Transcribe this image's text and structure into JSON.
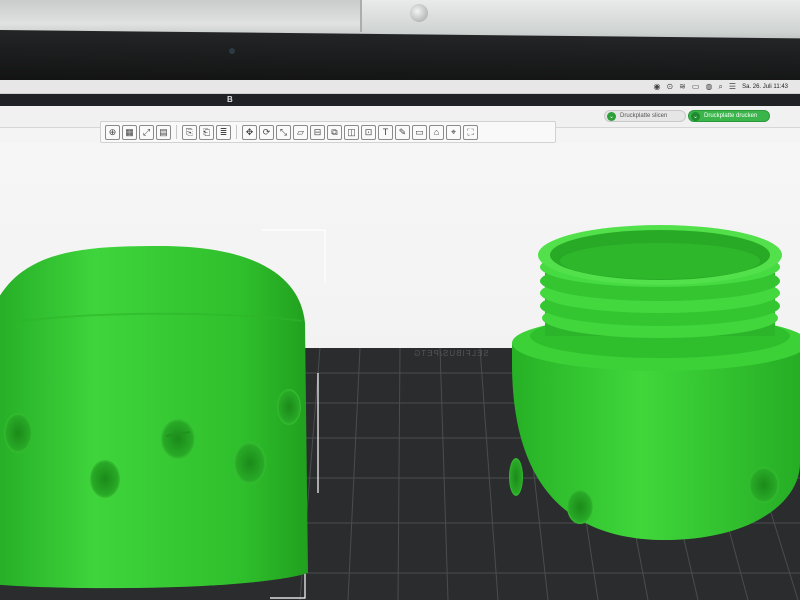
{
  "menubar": {
    "clock": "Sa. 26. Juli  11:43",
    "icons": [
      "record-icon",
      "control-icon",
      "wifi-icon",
      "cast-icon",
      "user-icon",
      "search-icon",
      "control-center-icon"
    ]
  },
  "app": {
    "title_glyph": "B"
  },
  "slicebar": {
    "slice_label": "Druckplatte slicen",
    "print_label": "Druckplatte drucken"
  },
  "toolbar": {
    "buttons": [
      {
        "name": "add-object-icon",
        "glyph": "⊕"
      },
      {
        "name": "arrange-icon",
        "glyph": "▦"
      },
      {
        "name": "orient-icon",
        "glyph": "⤢"
      },
      {
        "name": "plate-settings-icon",
        "glyph": "▤"
      },
      {
        "name": "copy-icon",
        "glyph": "⎘"
      },
      {
        "name": "paste-icon",
        "glyph": "⎗"
      },
      {
        "name": "layers-icon",
        "glyph": "≣"
      },
      {
        "name": "move-icon",
        "glyph": "✥"
      },
      {
        "name": "rotate-icon",
        "glyph": "⟳"
      },
      {
        "name": "scale-icon",
        "glyph": "⤡"
      },
      {
        "name": "lay-on-face-icon",
        "glyph": "▱"
      },
      {
        "name": "split-icon",
        "glyph": "⊟"
      },
      {
        "name": "boolean-icon",
        "glyph": "⧉"
      },
      {
        "name": "cube-icon",
        "glyph": "◫"
      },
      {
        "name": "cut-icon",
        "glyph": "⊡"
      },
      {
        "name": "text-icon",
        "glyph": "T"
      },
      {
        "name": "paint-icon",
        "glyph": "✎"
      },
      {
        "name": "seam-icon",
        "glyph": "▭"
      },
      {
        "name": "support-icon",
        "glyph": "⌂"
      },
      {
        "name": "measure-icon",
        "glyph": "⌖"
      },
      {
        "name": "assembly-icon",
        "glyph": "⛶"
      }
    ]
  },
  "viewport": {
    "plate_sticker": "SELFIBUS/PETG",
    "model_color": "#34c231",
    "plate_color": "#2b2c2e"
  }
}
